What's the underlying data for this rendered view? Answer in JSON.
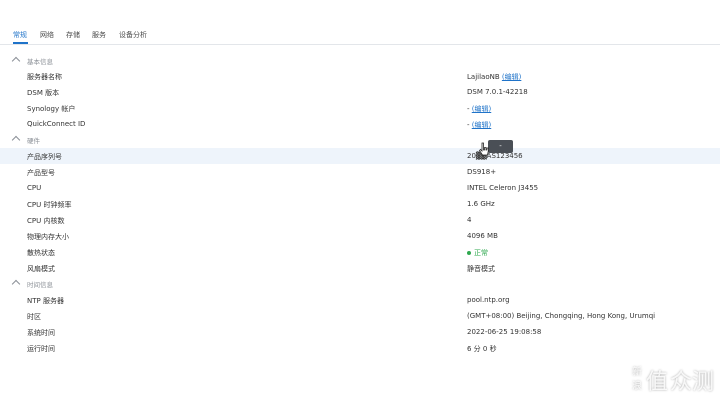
{
  "tabs": [
    {
      "label": "常规",
      "active": true
    },
    {
      "label": "网络",
      "active": false
    },
    {
      "label": "存储",
      "active": false
    },
    {
      "label": "服务",
      "active": false
    },
    {
      "label": "设备分析",
      "active": false
    }
  ],
  "sections": {
    "basic": {
      "title": "基本信息",
      "rows": [
        {
          "label": "服务器名称",
          "value": "LajilaoNB",
          "link": "(编辑)"
        },
        {
          "label": "DSM 版本",
          "value": "DSM 7.0.1-42218"
        },
        {
          "label": "Synology 帐户",
          "value": "-",
          "link": "(编辑)"
        },
        {
          "label": "QuickConnect ID",
          "value": "-",
          "link": "(编辑)"
        }
      ]
    },
    "hardware": {
      "title": "硬件",
      "rows": [
        {
          "label": "产品序列号",
          "value": "20▓▓AS123456"
        },
        {
          "label": "产品型号",
          "value": "DS918+"
        },
        {
          "label": "CPU",
          "value": "INTEL Celeron J3455"
        },
        {
          "label": "CPU 时钟频率",
          "value": "1.6 GHz"
        },
        {
          "label": "CPU 内核数",
          "value": "4"
        },
        {
          "label": "物理内存大小",
          "value": "4096 MB"
        },
        {
          "label": "散热状态",
          "value": "正常"
        },
        {
          "label": "风扇模式",
          "value": "静音模式"
        }
      ]
    },
    "time": {
      "title": "时间信息",
      "rows": [
        {
          "label": "NTP 服务器",
          "value": "pool.ntp.org"
        },
        {
          "label": "时区",
          "value": "(GMT+08:00) Beijing, Chongqing, Hong Kong, Urumqi"
        },
        {
          "label": "系统时间",
          "value": "2022-06-25 19:08:58"
        },
        {
          "label": "运行时间",
          "value": "6 分 0 秒"
        }
      ]
    }
  },
  "tooltip": "-",
  "status_color": "#2fa84f",
  "accent_color": "#1f73c9",
  "watermark": {
    "big": "值",
    "small_top": "新",
    "small_bottom": "浪",
    "rest": "众测"
  }
}
